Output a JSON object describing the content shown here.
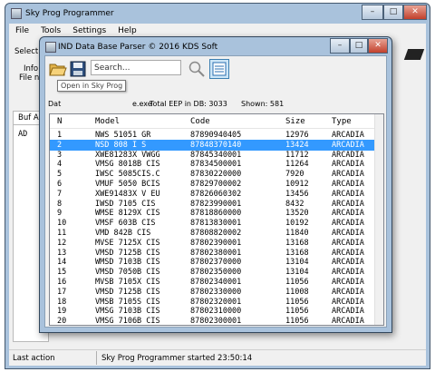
{
  "main": {
    "title": "Sky Prog Programmer",
    "menu": [
      "File",
      "Tools",
      "Settings",
      "Help"
    ],
    "partial": {
      "select_label": "Select",
      "info_label": "Info",
      "file_label": "File no",
      "tab_label": "Buf A",
      "ad_label": "AD"
    },
    "status": {
      "left": "Last action",
      "message": "Sky Prog Programmer started 23:50:14"
    }
  },
  "dialog": {
    "title": "IND Data Base Parser © 2016 KDS Soft",
    "search_placeholder": "Search...",
    "tooltip": "Open in Sky Prog",
    "info": {
      "partial_left": "Dat",
      "partial_right": "e.exe",
      "total": "Total EEP in DB: 3033",
      "shown": "Shown: 581"
    },
    "icons": [
      "open-folder-icon",
      "save-disk-icon",
      "search-icon",
      "list-view-icon"
    ]
  },
  "table": {
    "columns": [
      "N",
      "Model",
      "Code",
      "Size",
      "Type"
    ],
    "selected_index": 1,
    "rows": [
      [
        "1",
        "NWS 51051 GR",
        "87890940405",
        "12976",
        "ARCADIA"
      ],
      [
        "2",
        "NSD 808 I S",
        "87848370140",
        "13424",
        "ARCADIA"
      ],
      [
        "3",
        "XWE81283X VWGG",
        "87845340001",
        "11712",
        "ARCADIA"
      ],
      [
        "4",
        "VMSG 8018B CIS",
        "87834500001",
        "11264",
        "ARCADIA"
      ],
      [
        "5",
        "IWSC 5085CIS.C",
        "87830220000",
        "7920",
        "ARCADIA"
      ],
      [
        "6",
        "VMUF 5050 BCIS",
        "87829700002",
        "10912",
        "ARCADIA"
      ],
      [
        "7",
        "XWE91483X V EU",
        "87826060302",
        "13456",
        "ARCADIA"
      ],
      [
        "8",
        "IWSD 7105 CIS",
        "87823990001",
        "8432",
        "ARCADIA"
      ],
      [
        "9",
        "WMSE 8129X CIS",
        "87818860000",
        "13520",
        "ARCADIA"
      ],
      [
        "10",
        "VMSF 603B CIS",
        "87813830001",
        "10192",
        "ARCADIA"
      ],
      [
        "11",
        "VMD 842B CIS",
        "87808820002",
        "11840",
        "ARCADIA"
      ],
      [
        "12",
        "MVSE 7125X CIS",
        "87802390001",
        "13168",
        "ARCADIA"
      ],
      [
        "13",
        "VMSD 7125B CIS",
        "87802380001",
        "13168",
        "ARCADIA"
      ],
      [
        "14",
        "WMSD 7103B CIS",
        "87802370000",
        "13104",
        "ARCADIA"
      ],
      [
        "15",
        "VMSD 7050B CIS",
        "87802350000",
        "13104",
        "ARCADIA"
      ],
      [
        "16",
        "MVSB 7105X CIS",
        "87802340001",
        "11056",
        "ARCADIA"
      ],
      [
        "17",
        "VMSD 7125B CIS",
        "87802330000",
        "11008",
        "ARCADIA"
      ],
      [
        "18",
        "VMSB 7105S CIS",
        "87802320001",
        "11056",
        "ARCADIA"
      ],
      [
        "19",
        "VMSG 7103B CIS",
        "87802310000",
        "11056",
        "ARCADIA"
      ],
      [
        "20",
        "VMSG 7106B CIS",
        "87802300001",
        "11056",
        "ARCADIA"
      ]
    ]
  },
  "colors": {
    "selection": "#3399ff",
    "window_frame": "#a9c2dc",
    "close_button": "#c2402c"
  }
}
